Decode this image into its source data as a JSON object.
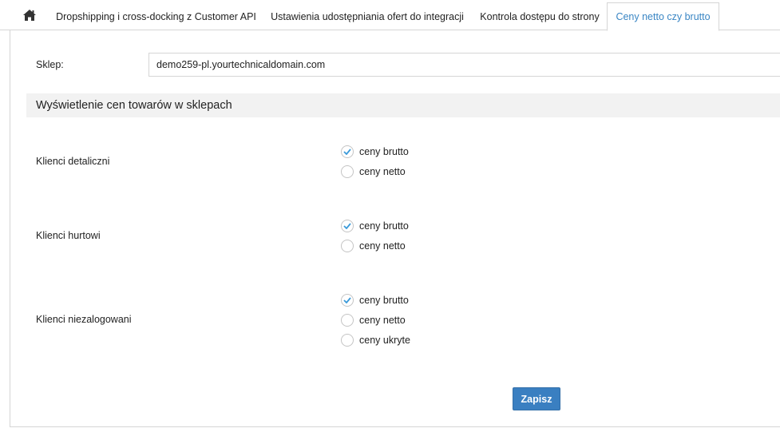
{
  "tabs": {
    "home_icon": "home-icon",
    "items": [
      {
        "label": "Dropshipping i cross-docking z Customer API",
        "active": false
      },
      {
        "label": "Ustawienia udostępniania ofert do integracji",
        "active": false
      },
      {
        "label": "Kontrola dostępu do strony",
        "active": false
      },
      {
        "label": "Ceny netto czy brutto",
        "active": true
      }
    ]
  },
  "shop": {
    "label": "Sklep:",
    "value": "demo259-pl.yourtechnicaldomain.com"
  },
  "section": {
    "title": "Wyświetlenie cen towarów w sklepach"
  },
  "groups": [
    {
      "label": "Klienci detaliczni",
      "options": [
        {
          "label": "ceny brutto",
          "selected": true
        },
        {
          "label": "ceny netto",
          "selected": false
        }
      ]
    },
    {
      "label": "Klienci hurtowi",
      "options": [
        {
          "label": "ceny brutto",
          "selected": true
        },
        {
          "label": "ceny netto",
          "selected": false
        }
      ]
    },
    {
      "label": "Klienci niezalogowani",
      "options": [
        {
          "label": "ceny brutto",
          "selected": true
        },
        {
          "label": "ceny netto",
          "selected": false
        },
        {
          "label": "ceny ukryte",
          "selected": false
        }
      ]
    }
  ],
  "actions": {
    "save_label": "Zapisz"
  },
  "colors": {
    "accent": "#3a86c4",
    "button": "#3a7fc1",
    "check": "#3a9ad9"
  }
}
